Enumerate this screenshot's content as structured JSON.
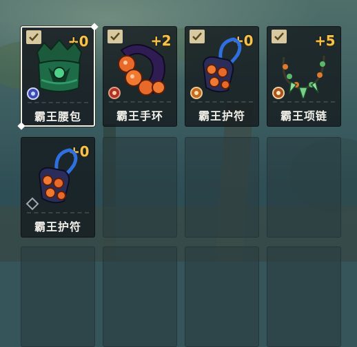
{
  "items": [
    {
      "name": "霸王腰包",
      "level": "+0",
      "checked": true,
      "selected": true,
      "gem": "blue-rune-gem-icon"
    },
    {
      "name": "霸王手环",
      "level": "+2",
      "checked": true,
      "selected": false,
      "gem": "red-rune-gem-icon"
    },
    {
      "name": "霸王护符",
      "level": "+0",
      "checked": true,
      "selected": false,
      "gem": "orange-rune-gem-icon"
    },
    {
      "name": "霸王项链",
      "level": "+5",
      "checked": true,
      "selected": false,
      "gem": "amber-rune-gem-icon"
    },
    {
      "name": "霸王护符",
      "level": "+0",
      "checked": false,
      "selected": false,
      "gem": "empty-gem-socket-icon"
    }
  ],
  "colors": {
    "level_gold": "#f6c24a",
    "check_bg": "#d8c9a0",
    "name_text": "#f1efe8",
    "selection_border": "#f3efe2"
  }
}
